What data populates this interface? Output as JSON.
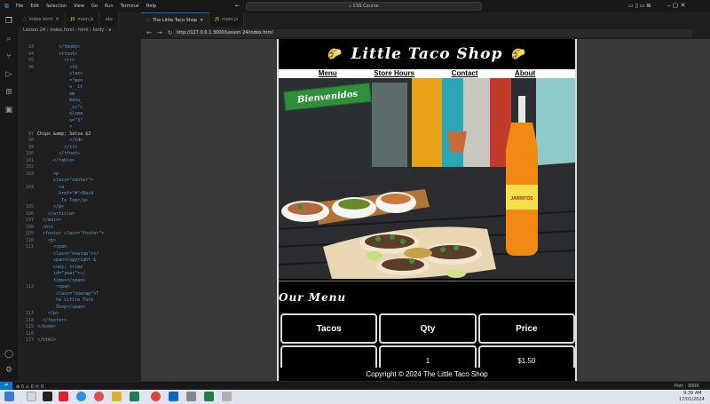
{
  "titlebar": {
    "menu": [
      "File",
      "Edit",
      "Selection",
      "View",
      "Go",
      "Run",
      "Terminal",
      "Help"
    ],
    "command_center": "CSS Course"
  },
  "editor": {
    "tabs": [
      {
        "label": "index.html",
        "active": false
      },
      {
        "label": "main.js",
        "active": false
      },
      {
        "label": "abc",
        "active": false
      }
    ],
    "breadcrumb": "Lesson 24 › index.html › html › body › a",
    "lines": [
      {
        "n": "93",
        "t": "        </tbody>"
      },
      {
        "n": "94",
        "t": "        <tfoot>"
      },
      {
        "n": "95",
        "t": "          <tr>"
      },
      {
        "n": "96",
        "t": "            <td"
      },
      {
        "n": "",
        "t": "            class"
      },
      {
        "n": "",
        "t": "            =\"men"
      },
      {
        "n": "",
        "t": "            u__it"
      },
      {
        "n": "",
        "t": "            em"
      },
      {
        "n": "",
        "t": "            menu_"
      },
      {
        "n": "",
        "t": "            _cs\"c"
      },
      {
        "n": "",
        "t": "            olspa"
      },
      {
        "n": "",
        "t": "            n=\"3\""
      },
      {
        "n": "",
        "t": "            >"
      },
      {
        "n": "97",
        "t": "Chips &amp; Salsa $2",
        "text": true
      },
      {
        "n": "98",
        "t": "            </td>"
      },
      {
        "n": "99",
        "t": "          </tr>"
      },
      {
        "n": "100",
        "t": "        </tfoot>"
      },
      {
        "n": "101",
        "t": "      </table>"
      },
      {
        "n": "102",
        "t": ""
      },
      {
        "n": "103",
        "t": "      <p"
      },
      {
        "n": "",
        "t": "      class=\"center\">"
      },
      {
        "n": "104",
        "t": "        <a"
      },
      {
        "n": "",
        "t": "        href=\"#\">Back"
      },
      {
        "n": "",
        "t": "         To Top</a>"
      },
      {
        "n": "105",
        "t": "      </p>"
      },
      {
        "n": "106",
        "t": "    </article>"
      },
      {
        "n": "107",
        "t": "  </main>"
      },
      {
        "n": "108",
        "t": "  <hr>"
      },
      {
        "n": "109",
        "t": "  <footer class=\"footer\">"
      },
      {
        "n": "110",
        "t": "    <p>"
      },
      {
        "n": "111",
        "t": "      <span"
      },
      {
        "n": "",
        "t": "      class=\"nowrap\"></"
      },
      {
        "n": "",
        "t": "      span>Copyright &"
      },
      {
        "n": "",
        "t": "      copy; <time"
      },
      {
        "n": "",
        "t": "      id=\"year\"></"
      },
      {
        "n": "",
        "t": "      time></span>"
      },
      {
        "n": "112",
        "t": "       <span"
      },
      {
        "n": "",
        "t": "       class=\"nowrap\">T"
      },
      {
        "n": "",
        "t": "       he Little Taco"
      },
      {
        "n": "",
        "t": "       Shop</span>"
      },
      {
        "n": "113",
        "t": "    </p>"
      },
      {
        "n": "114",
        "t": "  </footer>"
      },
      {
        "n": "115",
        "t": "</body>"
      },
      {
        "n": "116",
        "t": ""
      },
      {
        "n": "117",
        "t": "</html>"
      }
    ]
  },
  "preview": {
    "tabs": [
      {
        "label": "The Little Taco Shop",
        "active": true
      },
      {
        "label": "main.js",
        "active": false
      }
    ],
    "url": "http://127.0.0.1:3000/Lesson 24/index.html"
  },
  "site": {
    "title": "Little Taco Shop",
    "taco_emoji": "🌮",
    "nav": [
      "Menu",
      "Store Hours",
      "Contact",
      "About"
    ],
    "banner": "Bienvenidos",
    "bottle_label": "JARRITOS",
    "menu_heading": "Our Menu",
    "table": {
      "headers": [
        "Tacos",
        "Qty",
        "Price"
      ],
      "rows": [
        [
          "",
          "1",
          "$1.50"
        ]
      ]
    },
    "footer": "Copyright © 2024 The Little Taco Shop"
  },
  "statusbar": {
    "left": "⊗ 0  ⚠ 0   ⓦ 0",
    "right": "Port : 3000"
  },
  "taskbar": {
    "time": "9:39 AM",
    "date": "17/01/2024"
  }
}
